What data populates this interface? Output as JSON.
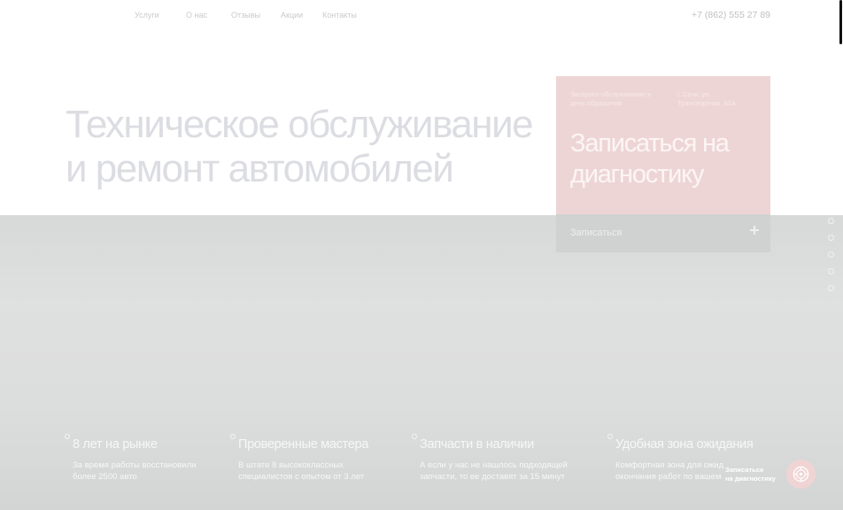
{
  "header": {
    "nav": [
      {
        "label": "Услуги"
      },
      {
        "label": "О нас"
      },
      {
        "label": "Отзывы"
      },
      {
        "label": "Акции"
      },
      {
        "label": "Контакты"
      }
    ],
    "phone": "+7 (862) 555 27 89"
  },
  "hero": {
    "title_line1": "Техническое обслуживание",
    "title_line2": "и ремонт автомобилей"
  },
  "booking_card": {
    "note_left": "Экспресс-обслуживание в день обращения",
    "note_right": "г. Сочи, ул. Транспортная, 61А",
    "title_line1": "Записаться на",
    "title_line2": "диагностику",
    "button_label": "Записаться",
    "button_icon": "plus-icon"
  },
  "slide_dots": [
    {
      "icon": "circle-icon"
    },
    {
      "icon": "circle-icon"
    },
    {
      "icon": "circle-icon"
    },
    {
      "icon": "circle-icon"
    },
    {
      "icon": "circle-icon"
    }
  ],
  "features": [
    {
      "title": "8 лет на рынке",
      "desc_line1": "За время работы восстановили",
      "desc_line2": "более 2500 авто"
    },
    {
      "title": "Проверенные мастера",
      "desc_line1": "В штате 8 высококлассных",
      "desc_line2": "специалистов с опытом от 3 лет"
    },
    {
      "title": "Запчасти в наличии",
      "desc_line1": "А если у нас не нашлось подходящей",
      "desc_line2": "запчасти, то ее доставят за 15 минут"
    },
    {
      "title": "Удобная зона ожидания",
      "desc_line1": "Комфортная зона для ожид",
      "desc_line2": "окончания работ по вашем"
    }
  ],
  "floating_cta": {
    "line1": "Записаться",
    "line2": "на диагностику",
    "icon": "wheel-icon"
  },
  "colors": {
    "accent": "#eed5d5",
    "hero_bg": "#dcdddd"
  }
}
